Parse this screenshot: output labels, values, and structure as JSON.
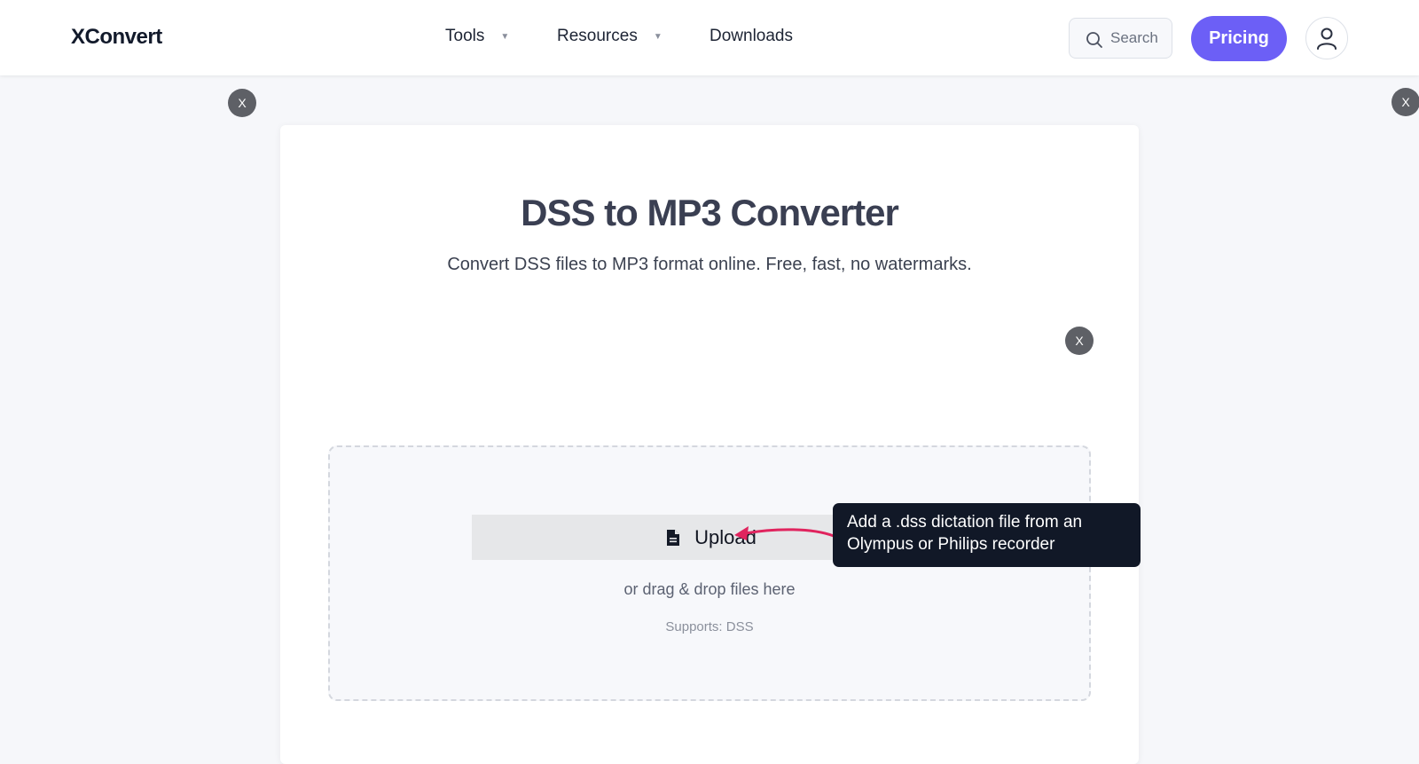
{
  "header": {
    "logo": "XConvert",
    "nav": [
      {
        "label": "Tools",
        "caret": "▼"
      },
      {
        "label": "Resources",
        "caret": "▼"
      },
      {
        "label": "Downloads"
      }
    ],
    "search_label": "Search",
    "pricing_label": "Pricing"
  },
  "overlays": {
    "close_label": "X"
  },
  "main": {
    "title": "DSS to MP3 Converter",
    "subtitle": "Convert DSS files to MP3 format online. Free, fast, no watermarks.",
    "upload_label": "Upload",
    "drop_hint": "or drag & drop files here",
    "supports": "Supports: DSS"
  },
  "tooltip": {
    "text": "Add a .dss dictation file from an Olympus or Philips recorder"
  },
  "colors": {
    "accent": "#6c5ff6",
    "tooltip_bg": "#111827",
    "arrow": "#e0245e"
  }
}
